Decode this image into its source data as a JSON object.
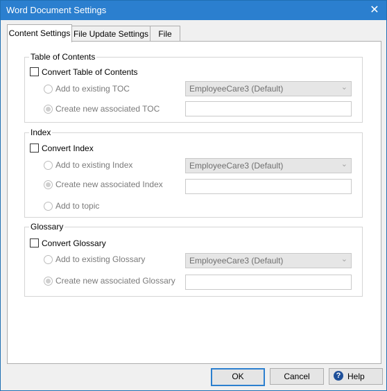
{
  "window": {
    "title": "Word Document Settings",
    "close_glyph": "✕"
  },
  "tabs": [
    {
      "label": "Content Settings",
      "active": true
    },
    {
      "label": "File Update Settings",
      "active": false
    },
    {
      "label": "File",
      "active": false
    }
  ],
  "toc": {
    "group_label": "Table of Contents",
    "convert_label": "Convert Table of Contents",
    "convert_checked": false,
    "add_existing_label": "Add to existing TOC",
    "combo_value": "EmployeeCare3 (Default)",
    "create_new_label": "Create new associated  TOC",
    "create_new_value": ""
  },
  "index": {
    "group_label": "Index",
    "convert_label": "Convert Index",
    "convert_checked": false,
    "add_existing_label": "Add  to existing Index",
    "combo_value": "EmployeeCare3 (Default)",
    "create_new_label": "Create new associated Index",
    "create_new_value": "",
    "add_topic_label": "Add to topic"
  },
  "glossary": {
    "group_label": "Glossary",
    "convert_label": "Convert Glossary",
    "convert_checked": false,
    "add_existing_label": "Add to existing Glossary",
    "combo_value": "EmployeeCare3 (Default)",
    "create_new_label": "Create new associated Glossary",
    "create_new_value": ""
  },
  "footer": {
    "ok_label": "OK",
    "cancel_label": "Cancel",
    "help_label": "Help",
    "help_icon_glyph": "?"
  },
  "colors": {
    "titlebar": "#2b7fcf",
    "ok_border": "#2b7fcf",
    "help_icon": "#1e4f99"
  },
  "icons": {
    "close": "close-icon",
    "combo_arrow": "chevron-down-icon",
    "help": "help-icon"
  }
}
